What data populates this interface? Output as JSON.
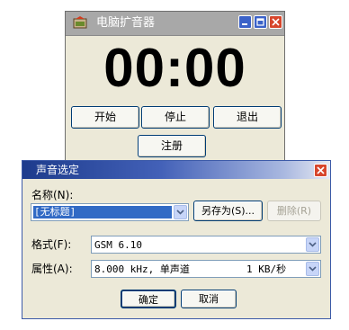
{
  "main_window": {
    "title": "电脑扩音器",
    "timer": "00:00",
    "buttons": {
      "start": "开始",
      "stop": "停止",
      "exit": "退出",
      "register": "注册"
    }
  },
  "dialog": {
    "title": "声音选定",
    "name_label": "名称(N):",
    "name_value": "[无标题]",
    "save_as_label": "另存为(S)...",
    "delete_label": "删除(R)",
    "format_label": "格式(F):",
    "format_value": "GSM 6.10",
    "attributes_label": "属性(A):",
    "attributes_value": "8.000 kHz, 单声道",
    "attributes_rate": "1 KB/秒",
    "ok_label": "确定",
    "cancel_label": "取消"
  },
  "colors": {
    "window_face": "#ece9d8",
    "inactive_titlebar": "#a8a8a8",
    "active_titlebar": "#1d3b8c",
    "selection": "#316ac5",
    "close_button": "#d7462c"
  },
  "icons": [
    "app-icon",
    "minimize-icon",
    "maximize-icon",
    "close-icon",
    "dropdown-arrow-icon"
  ]
}
